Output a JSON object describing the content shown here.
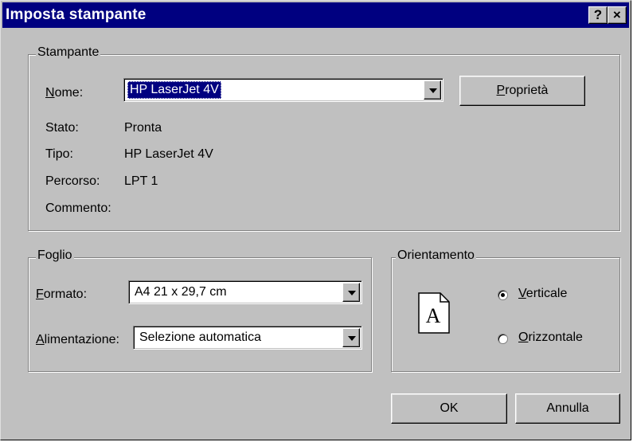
{
  "window": {
    "title": "Imposta stampante",
    "help_glyph": "?",
    "close_glyph": "×"
  },
  "printer": {
    "legend": "Stampante",
    "name_label": "Nome:",
    "name_value": "HP LaserJet 4V",
    "properties_button": "Proprietà",
    "status_label": "Stato:",
    "status_value": "Pronta",
    "type_label": "Tipo:",
    "type_value": "HP LaserJet 4V",
    "path_label": "Percorso:",
    "path_value": "LPT 1",
    "comment_label": "Commento:"
  },
  "paper": {
    "legend": "Foglio",
    "format_label": "Formato:",
    "format_value": "A4 21 x 29,7 cm",
    "source_label": "Alimentazione:",
    "source_value": "Selezione automatica"
  },
  "orientation": {
    "legend": "Orientamento",
    "page_letter": "A",
    "options": [
      {
        "label": "Verticale",
        "selected": true
      },
      {
        "label": "Orizzontale",
        "selected": false
      }
    ]
  },
  "buttons": {
    "ok": "OK",
    "cancel": "Annulla"
  }
}
